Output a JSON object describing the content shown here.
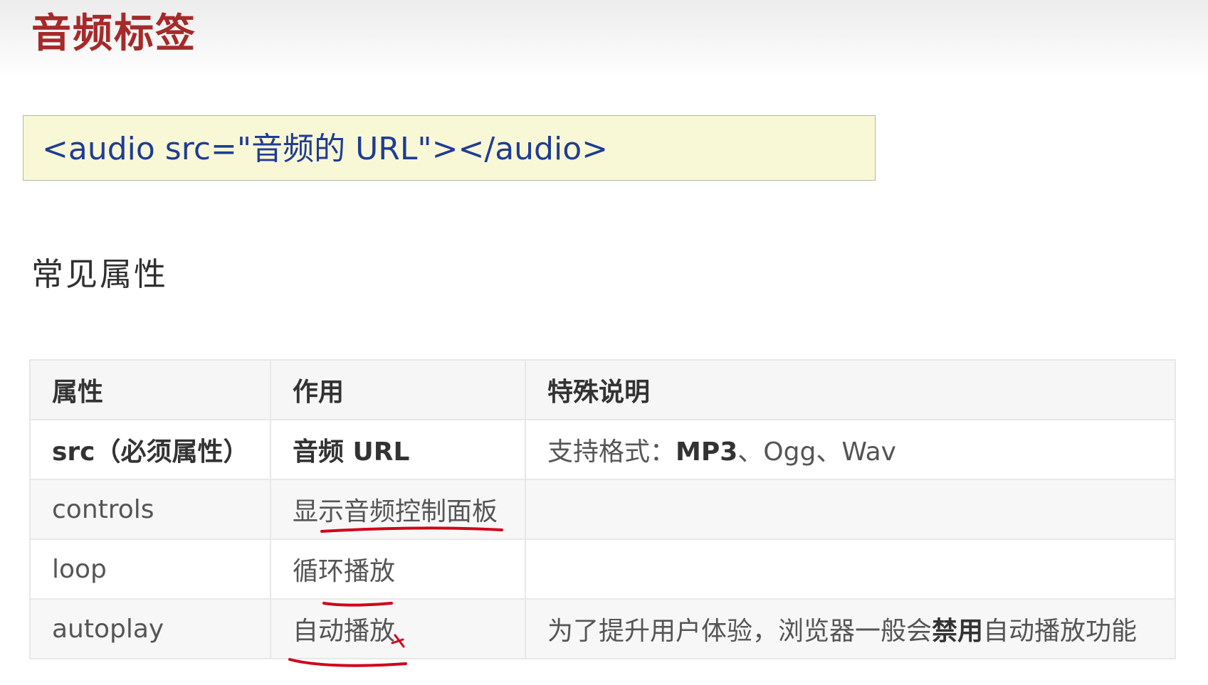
{
  "title": "音频标签",
  "code": "<audio src=\"音频的 URL\"></audio>",
  "section_heading": "常见属性",
  "table": {
    "headers": [
      "属性",
      "作用",
      "特殊说明"
    ],
    "rows": [
      {
        "attr": "src（必须属性）",
        "purpose": "音频 URL",
        "note_prefix": "支持格式：",
        "note_bold": "MP3",
        "note_suffix": "、Ogg、Wav"
      },
      {
        "attr": "controls",
        "purpose": "显示音频控制面板",
        "note": ""
      },
      {
        "attr": "loop",
        "purpose": "循环播放",
        "note": ""
      },
      {
        "attr": "autoplay",
        "purpose": "自动播放",
        "note_prefix": "为了提升用户体验，浏览器一般会",
        "note_bold": "禁用",
        "note_suffix": "自动播放功能"
      }
    ]
  },
  "annotation_color": "#d0021b"
}
